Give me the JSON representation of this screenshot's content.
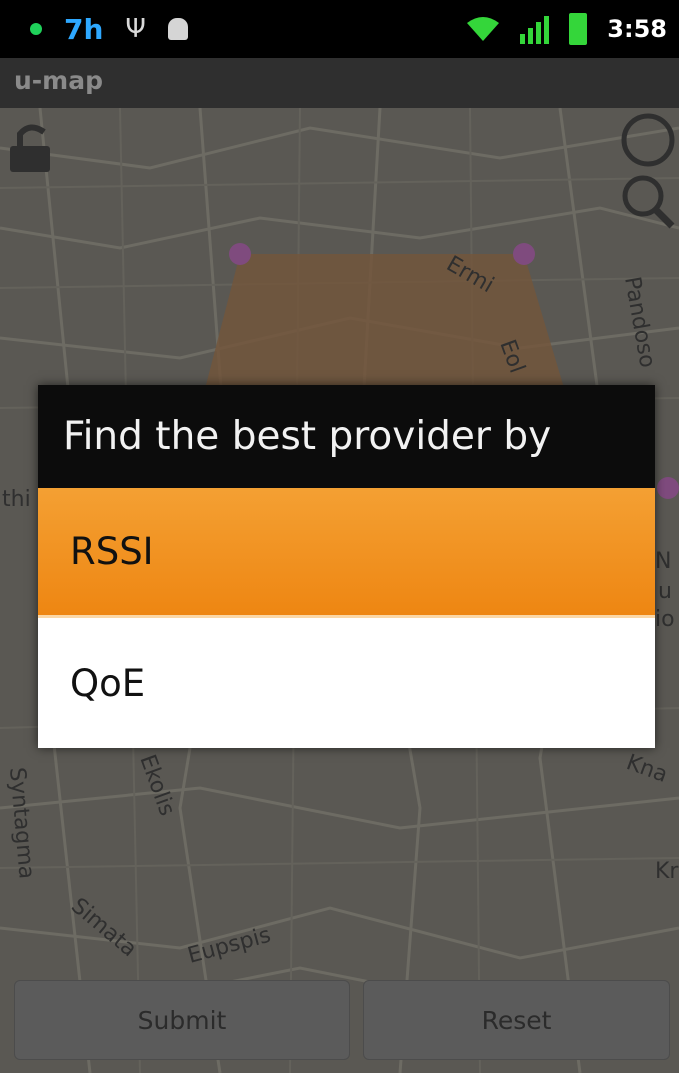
{
  "status_bar": {
    "notification_count": "7h",
    "time": "3:58",
    "icons": [
      "notification-dot-icon",
      "usb-icon",
      "android-debug-icon",
      "wifi-icon",
      "signal-icon",
      "battery-icon"
    ]
  },
  "app": {
    "title": "u-map"
  },
  "map": {
    "labels": [
      "Ermi",
      "Eol",
      "Pandoso",
      "thi",
      "N",
      "u",
      "io",
      "Kna",
      "Kr",
      "Ekolis",
      "Syntagma",
      "Simata",
      "Eupspis"
    ]
  },
  "dialog": {
    "title": "Find the best provider by",
    "options": [
      {
        "label": "RSSI",
        "selected": true
      },
      {
        "label": "QoE",
        "selected": false
      }
    ],
    "selected_color": "#f29428"
  },
  "buttons": {
    "submit": "Submit",
    "reset": "Reset"
  }
}
